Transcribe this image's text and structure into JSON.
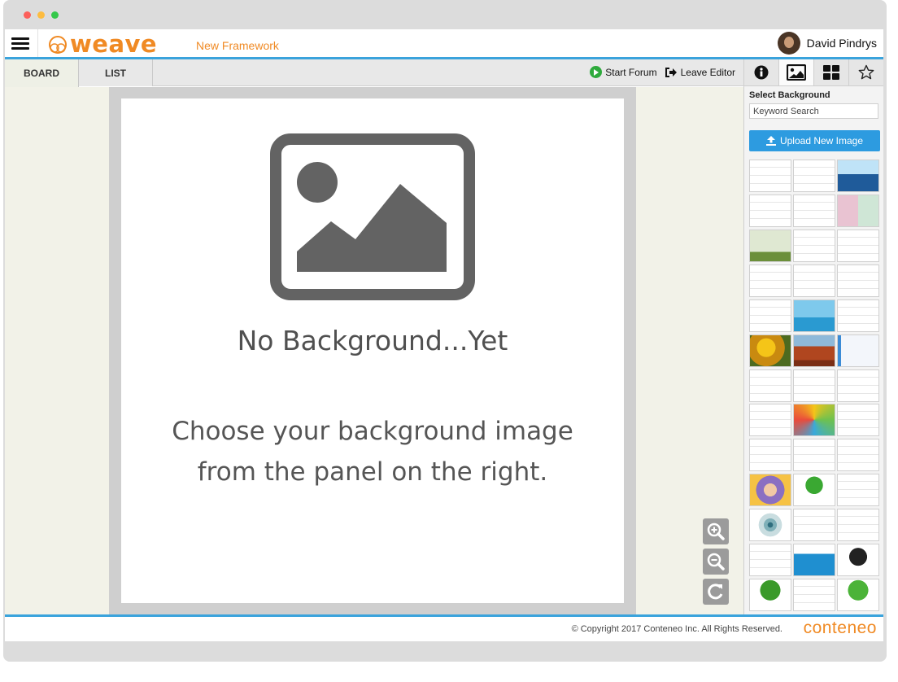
{
  "header": {
    "app_name": "weave",
    "framework_title": "New Framework",
    "user_name": "David Pindrys"
  },
  "tabs": [
    {
      "label": "BOARD",
      "active": true
    },
    {
      "label": "LIST",
      "active": false
    }
  ],
  "actions": {
    "start_forum": "Start Forum",
    "leave_editor": "Leave Editor"
  },
  "board": {
    "placeholder_title": "No Background...Yet",
    "placeholder_line1": "Choose your background image",
    "placeholder_line2": "from the panel on the right.",
    "zoom_in_icon": "zoom-in-icon",
    "zoom_out_icon": "zoom-out-icon",
    "reset_icon": "rotate-icon"
  },
  "panel": {
    "tabs": [
      {
        "icon": "info-icon",
        "active": false
      },
      {
        "icon": "image-icon",
        "active": true
      },
      {
        "icon": "grid-icon",
        "active": false
      },
      {
        "icon": "star-icon",
        "active": false
      }
    ],
    "title": "Select Background",
    "search_placeholder": "Keyword Search",
    "upload_label": "Upload New Image",
    "thumbnails": [
      "table-template",
      "worksheet-template",
      "sailboat-ocean",
      "blank-notes",
      "blank-chart",
      "color-quadrants",
      "tree-photo",
      "blank-board",
      "two-column",
      "four-square",
      "target-diagram",
      "blank-page",
      "sticky-grid",
      "sailboat-sky",
      "arrows-template",
      "sunflowers",
      "red-rock-desert",
      "blue-grid",
      "lined-template",
      "tree-sketch",
      "cross-quadrants",
      "tape-roll",
      "color-wheel",
      "quad-grid",
      "axis-chart",
      "axis-chart-2",
      "axis-chart-3",
      "portrait-circle",
      "cartoon-tree",
      "radial-diagram",
      "ripple-circles",
      "venn-template",
      "four-quadrant",
      "blank-lines",
      "ship-ocean",
      "black-tree",
      "green-tree",
      "white-tree",
      "green-tree-2"
    ]
  },
  "footer": {
    "copyright": "© Copyright 2017 Conteneo Inc. All Rights Reserved.",
    "brand": "conteneo"
  },
  "colors": {
    "accent": "#3aa3dc",
    "brand_orange": "#f08a24",
    "upload_blue": "#2d9be0"
  }
}
